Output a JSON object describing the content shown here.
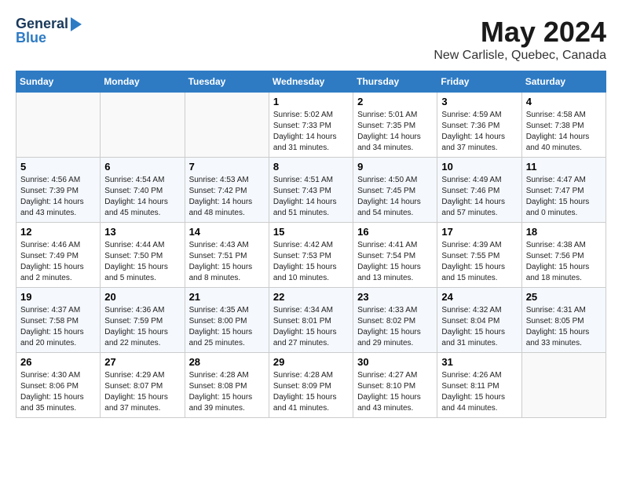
{
  "header": {
    "logo": {
      "general": "General",
      "blue": "Blue",
      "tagline": "GeneralBlue"
    },
    "title": "May 2024",
    "location": "New Carlisle, Quebec, Canada"
  },
  "days_of_week": [
    "Sunday",
    "Monday",
    "Tuesday",
    "Wednesday",
    "Thursday",
    "Friday",
    "Saturday"
  ],
  "weeks": [
    {
      "days": [
        {
          "number": "",
          "info": ""
        },
        {
          "number": "",
          "info": ""
        },
        {
          "number": "",
          "info": ""
        },
        {
          "number": "1",
          "sunrise": "Sunrise: 5:02 AM",
          "sunset": "Sunset: 7:33 PM",
          "daylight": "Daylight: 14 hours and 31 minutes."
        },
        {
          "number": "2",
          "sunrise": "Sunrise: 5:01 AM",
          "sunset": "Sunset: 7:35 PM",
          "daylight": "Daylight: 14 hours and 34 minutes."
        },
        {
          "number": "3",
          "sunrise": "Sunrise: 4:59 AM",
          "sunset": "Sunset: 7:36 PM",
          "daylight": "Daylight: 14 hours and 37 minutes."
        },
        {
          "number": "4",
          "sunrise": "Sunrise: 4:58 AM",
          "sunset": "Sunset: 7:38 PM",
          "daylight": "Daylight: 14 hours and 40 minutes."
        }
      ]
    },
    {
      "days": [
        {
          "number": "5",
          "sunrise": "Sunrise: 4:56 AM",
          "sunset": "Sunset: 7:39 PM",
          "daylight": "Daylight: 14 hours and 43 minutes."
        },
        {
          "number": "6",
          "sunrise": "Sunrise: 4:54 AM",
          "sunset": "Sunset: 7:40 PM",
          "daylight": "Daylight: 14 hours and 45 minutes."
        },
        {
          "number": "7",
          "sunrise": "Sunrise: 4:53 AM",
          "sunset": "Sunset: 7:42 PM",
          "daylight": "Daylight: 14 hours and 48 minutes."
        },
        {
          "number": "8",
          "sunrise": "Sunrise: 4:51 AM",
          "sunset": "Sunset: 7:43 PM",
          "daylight": "Daylight: 14 hours and 51 minutes."
        },
        {
          "number": "9",
          "sunrise": "Sunrise: 4:50 AM",
          "sunset": "Sunset: 7:45 PM",
          "daylight": "Daylight: 14 hours and 54 minutes."
        },
        {
          "number": "10",
          "sunrise": "Sunrise: 4:49 AM",
          "sunset": "Sunset: 7:46 PM",
          "daylight": "Daylight: 14 hours and 57 minutes."
        },
        {
          "number": "11",
          "sunrise": "Sunrise: 4:47 AM",
          "sunset": "Sunset: 7:47 PM",
          "daylight": "Daylight: 15 hours and 0 minutes."
        }
      ]
    },
    {
      "days": [
        {
          "number": "12",
          "sunrise": "Sunrise: 4:46 AM",
          "sunset": "Sunset: 7:49 PM",
          "daylight": "Daylight: 15 hours and 2 minutes."
        },
        {
          "number": "13",
          "sunrise": "Sunrise: 4:44 AM",
          "sunset": "Sunset: 7:50 PM",
          "daylight": "Daylight: 15 hours and 5 minutes."
        },
        {
          "number": "14",
          "sunrise": "Sunrise: 4:43 AM",
          "sunset": "Sunset: 7:51 PM",
          "daylight": "Daylight: 15 hours and 8 minutes."
        },
        {
          "number": "15",
          "sunrise": "Sunrise: 4:42 AM",
          "sunset": "Sunset: 7:53 PM",
          "daylight": "Daylight: 15 hours and 10 minutes."
        },
        {
          "number": "16",
          "sunrise": "Sunrise: 4:41 AM",
          "sunset": "Sunset: 7:54 PM",
          "daylight": "Daylight: 15 hours and 13 minutes."
        },
        {
          "number": "17",
          "sunrise": "Sunrise: 4:39 AM",
          "sunset": "Sunset: 7:55 PM",
          "daylight": "Daylight: 15 hours and 15 minutes."
        },
        {
          "number": "18",
          "sunrise": "Sunrise: 4:38 AM",
          "sunset": "Sunset: 7:56 PM",
          "daylight": "Daylight: 15 hours and 18 minutes."
        }
      ]
    },
    {
      "days": [
        {
          "number": "19",
          "sunrise": "Sunrise: 4:37 AM",
          "sunset": "Sunset: 7:58 PM",
          "daylight": "Daylight: 15 hours and 20 minutes."
        },
        {
          "number": "20",
          "sunrise": "Sunrise: 4:36 AM",
          "sunset": "Sunset: 7:59 PM",
          "daylight": "Daylight: 15 hours and 22 minutes."
        },
        {
          "number": "21",
          "sunrise": "Sunrise: 4:35 AM",
          "sunset": "Sunset: 8:00 PM",
          "daylight": "Daylight: 15 hours and 25 minutes."
        },
        {
          "number": "22",
          "sunrise": "Sunrise: 4:34 AM",
          "sunset": "Sunset: 8:01 PM",
          "daylight": "Daylight: 15 hours and 27 minutes."
        },
        {
          "number": "23",
          "sunrise": "Sunrise: 4:33 AM",
          "sunset": "Sunset: 8:02 PM",
          "daylight": "Daylight: 15 hours and 29 minutes."
        },
        {
          "number": "24",
          "sunrise": "Sunrise: 4:32 AM",
          "sunset": "Sunset: 8:04 PM",
          "daylight": "Daylight: 15 hours and 31 minutes."
        },
        {
          "number": "25",
          "sunrise": "Sunrise: 4:31 AM",
          "sunset": "Sunset: 8:05 PM",
          "daylight": "Daylight: 15 hours and 33 minutes."
        }
      ]
    },
    {
      "days": [
        {
          "number": "26",
          "sunrise": "Sunrise: 4:30 AM",
          "sunset": "Sunset: 8:06 PM",
          "daylight": "Daylight: 15 hours and 35 minutes."
        },
        {
          "number": "27",
          "sunrise": "Sunrise: 4:29 AM",
          "sunset": "Sunset: 8:07 PM",
          "daylight": "Daylight: 15 hours and 37 minutes."
        },
        {
          "number": "28",
          "sunrise": "Sunrise: 4:28 AM",
          "sunset": "Sunset: 8:08 PM",
          "daylight": "Daylight: 15 hours and 39 minutes."
        },
        {
          "number": "29",
          "sunrise": "Sunrise: 4:28 AM",
          "sunset": "Sunset: 8:09 PM",
          "daylight": "Daylight: 15 hours and 41 minutes."
        },
        {
          "number": "30",
          "sunrise": "Sunrise: 4:27 AM",
          "sunset": "Sunset: 8:10 PM",
          "daylight": "Daylight: 15 hours and 43 minutes."
        },
        {
          "number": "31",
          "sunrise": "Sunrise: 4:26 AM",
          "sunset": "Sunset: 8:11 PM",
          "daylight": "Daylight: 15 hours and 44 minutes."
        },
        {
          "number": "",
          "info": ""
        }
      ]
    }
  ]
}
